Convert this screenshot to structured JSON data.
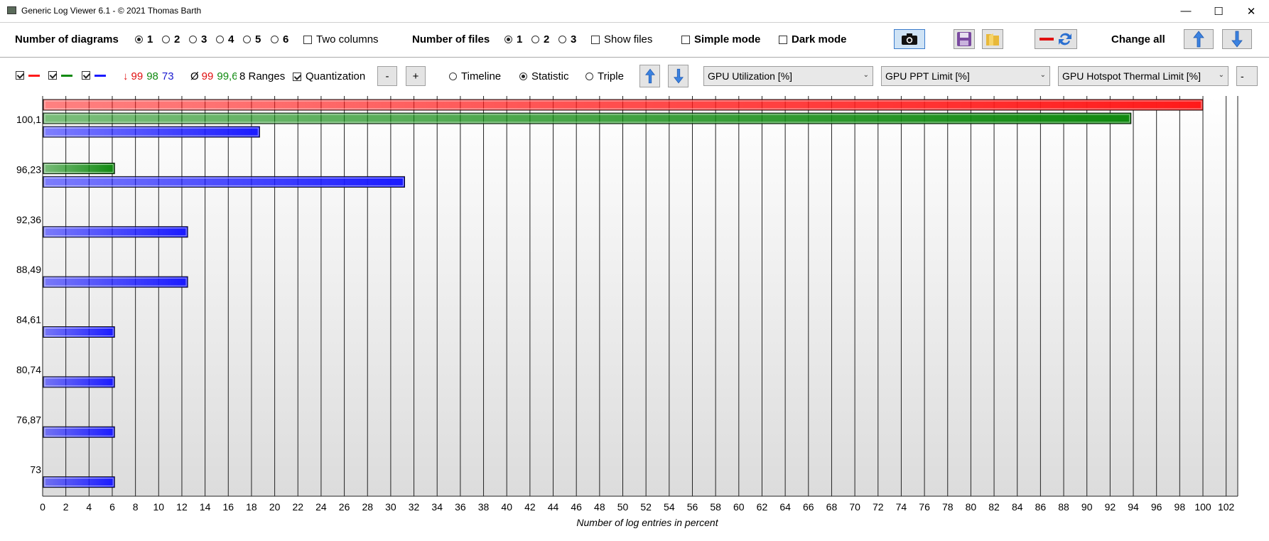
{
  "app": {
    "title": "Generic Log Viewer 6.1 - © 2021 Thomas Barth"
  },
  "window_buttons": {
    "minimize": "—",
    "maximize": "☐",
    "close": "✕"
  },
  "toolbar1": {
    "diagrams_label": "Number of diagrams",
    "diagram_options": [
      "1",
      "2",
      "3",
      "4",
      "5",
      "6"
    ],
    "diagram_selected": "1",
    "two_columns_label": "Two columns",
    "files_label": "Number of files",
    "file_options": [
      "1",
      "2",
      "3"
    ],
    "file_selected": "1",
    "show_files_label": "Show files",
    "simple_mode_label": "Simple mode",
    "dark_mode_label": "Dark mode",
    "change_all_label": "Change all",
    "icons": {
      "screenshot": "camera-icon",
      "save": "floppy-disk-icon",
      "open": "folder-icon",
      "swap_colors": "swap-colors-icon",
      "up": "arrow-up-icon",
      "down": "arrow-down-icon"
    }
  },
  "toolbar2": {
    "series_toggles": [
      {
        "checked": true,
        "color": "#ff1a1a"
      },
      {
        "checked": true,
        "color": "#108a10"
      },
      {
        "checked": true,
        "color": "#1a1aff"
      }
    ],
    "min_symbol": "↓",
    "min_values": [
      {
        "text": "99",
        "color": "#e01010"
      },
      {
        "text": "98",
        "color": "#108a10"
      },
      {
        "text": "73",
        "color": "#1a1ad0"
      }
    ],
    "avg_symbol": "Ø",
    "avg_values": [
      {
        "text": "99",
        "color": "#e01010"
      },
      {
        "text": "99,6",
        "color": "#108a10"
      }
    ],
    "ranges_label": "8 Ranges",
    "quantization_label": "Quantization",
    "quantization_checked": true,
    "minus_label": "-",
    "plus_label": "+",
    "view_modes": [
      "Timeline",
      "Statistic",
      "Triple"
    ],
    "view_selected": "Statistic",
    "sensor_selects": [
      "GPU Utilization [%]",
      "GPU PPT Limit [%]",
      "GPU Hotspot Thermal Limit [%]"
    ]
  },
  "chart_data": {
    "type": "bar",
    "orientation": "horizontal",
    "xlabel": "Number of log entries in percent",
    "xlim": [
      0,
      103
    ],
    "x_ticks": [
      0,
      2,
      4,
      6,
      8,
      10,
      12,
      14,
      16,
      18,
      20,
      22,
      24,
      26,
      28,
      30,
      32,
      34,
      36,
      38,
      40,
      42,
      44,
      46,
      48,
      50,
      52,
      54,
      56,
      58,
      60,
      62,
      64,
      66,
      68,
      70,
      72,
      74,
      76,
      78,
      80,
      82,
      84,
      86,
      88,
      90,
      92,
      94,
      96,
      98,
      100,
      102
    ],
    "categories": [
      "100,1",
      "96,23",
      "92,36",
      "88,49",
      "84,61",
      "80,74",
      "76,87",
      "73"
    ],
    "series": [
      {
        "color": "#ff1a1a",
        "values": [
          100,
          0,
          0,
          0,
          0,
          0,
          0,
          0
        ]
      },
      {
        "color": "#108a10",
        "values": [
          93.8,
          6.2,
          0,
          0,
          0,
          0,
          0,
          0
        ]
      },
      {
        "color": "#1a1aff",
        "values": [
          18.7,
          31.2,
          12.5,
          12.5,
          6.2,
          6.2,
          6.2,
          6.2
        ]
      }
    ],
    "grid": true,
    "background": "gradient"
  }
}
